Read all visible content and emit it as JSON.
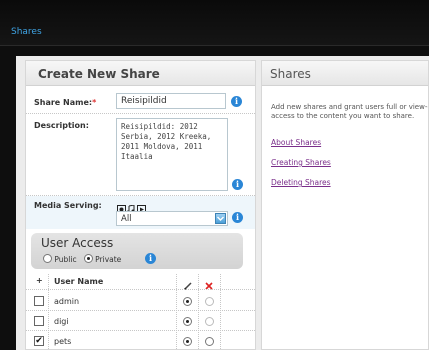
{
  "header": {
    "brand": "Shares"
  },
  "create_panel": {
    "title": "Create New Share",
    "share_name_label": "Share Name:",
    "required_mark": "*",
    "share_name_value": "Reisipildid",
    "description_label": "Description:",
    "description_value": "Reisipildid: 2012 Serbia, 2012 Kreeka, 2011 Moldova, 2011 Itaalia",
    "media_serving_label": "Media Serving:",
    "media_serving_selected": "All",
    "media_icons": [
      "photo-icon",
      "music-icon",
      "video-icon"
    ],
    "user_access": {
      "title": "User Access",
      "public_label": "Public",
      "private_label": "Private",
      "selected": "private",
      "columns": {
        "add": "+",
        "user_name": "User Name"
      },
      "users": [
        {
          "name": "admin",
          "checked": false,
          "access": "full"
        },
        {
          "name": "digi",
          "checked": false,
          "access": "full"
        },
        {
          "name": "pets",
          "checked": true,
          "access": "full"
        }
      ]
    }
  },
  "shares_panel": {
    "title": "Shares",
    "description": "Add new shares and grant users full or view-only access to the content you want to share.",
    "links": [
      "About Shares",
      "Creating Shares",
      "Deleting Shares"
    ]
  },
  "colors": {
    "accent": "#2a86d6",
    "brand": "#3fa3e3",
    "link": "#7a2e8a",
    "required": "#dd3333"
  }
}
